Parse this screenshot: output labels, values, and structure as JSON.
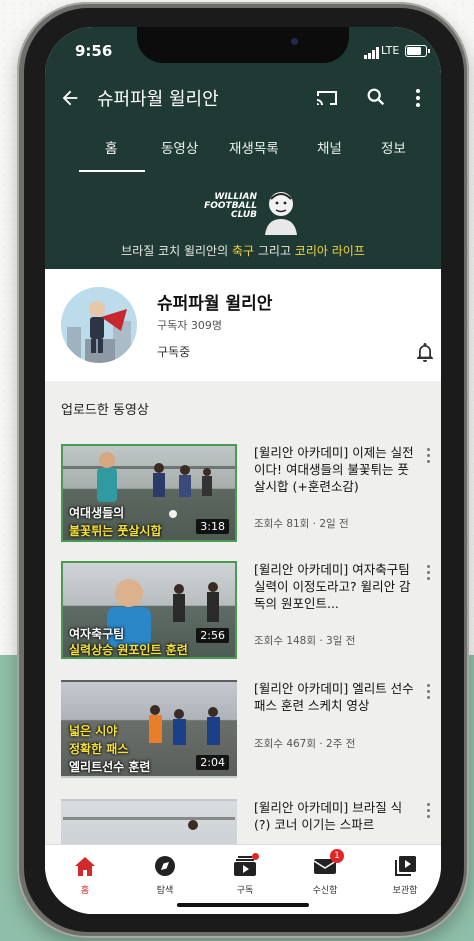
{
  "status": {
    "time": "9:56",
    "network": "LTE"
  },
  "appbar": {
    "title": "슈퍼파월 윌리안"
  },
  "tabs": [
    {
      "label": "홈"
    },
    {
      "label": "동영상"
    },
    {
      "label": "재생목록"
    },
    {
      "label": "채널"
    },
    {
      "label": "정보"
    }
  ],
  "banner": {
    "logo_line1": "WILLIAN",
    "logo_line2": "FOOTBALL",
    "logo_line3": "CLUB",
    "tag_a": "브라질 코치 윌리안의 ",
    "tag_b": "축구",
    "tag_c": " 그리고 ",
    "tag_d": "코리아 라이프"
  },
  "channel": {
    "name": "슈퍼파월 윌리안",
    "subscribers": "구독자 309명",
    "subscribed_label": "구독중"
  },
  "uploads": {
    "title": "업로드한 동영상",
    "videos": [
      {
        "title": "[윌리안 아카데미] 이제는 실전이다! 여대생들의 불꽃튀는 풋살시합 (+훈련소감)",
        "meta": "조회수 81회 · 2일 전",
        "duration": "3:18",
        "cap1": "여대생들의",
        "cap2": "불꽃튀는 풋살시합",
        "cap3": ""
      },
      {
        "title": "[윌리안 아카데미] 여자축구팀 실력이 이정도라고? 윌리안 감독의 원포인트...",
        "meta": "조회수 148회 · 3일 전",
        "duration": "2:56",
        "cap1": "여자축구팀",
        "cap2": "실력상승 원포인트 훈련",
        "cap3": ""
      },
      {
        "title": "[윌리안 아카데미] 엘리트 선수 패스 훈련 스케치 영상",
        "meta": "조회수 467회 · 2주 전",
        "duration": "2:04",
        "cap1": "넓은 시야",
        "cap2": "정확한 패스",
        "cap3": "엘리트선수 훈련"
      },
      {
        "title": "[윌리안 아카데미] 브라질 식(?) 코너 이기는 스파르",
        "meta": "",
        "duration": "",
        "cap1": "",
        "cap2": "",
        "cap3": ""
      }
    ]
  },
  "bottomnav": {
    "items": [
      {
        "label": "홈",
        "icon": "home-icon"
      },
      {
        "label": "탐색",
        "icon": "compass-icon"
      },
      {
        "label": "구독",
        "icon": "subscriptions-icon"
      },
      {
        "label": "수신함",
        "icon": "inbox-icon",
        "badge": "1"
      },
      {
        "label": "보관함",
        "icon": "library-icon"
      }
    ]
  },
  "colors": {
    "header": "#1f3a34",
    "accent": "#f3d33b",
    "active": "#d2292a"
  }
}
